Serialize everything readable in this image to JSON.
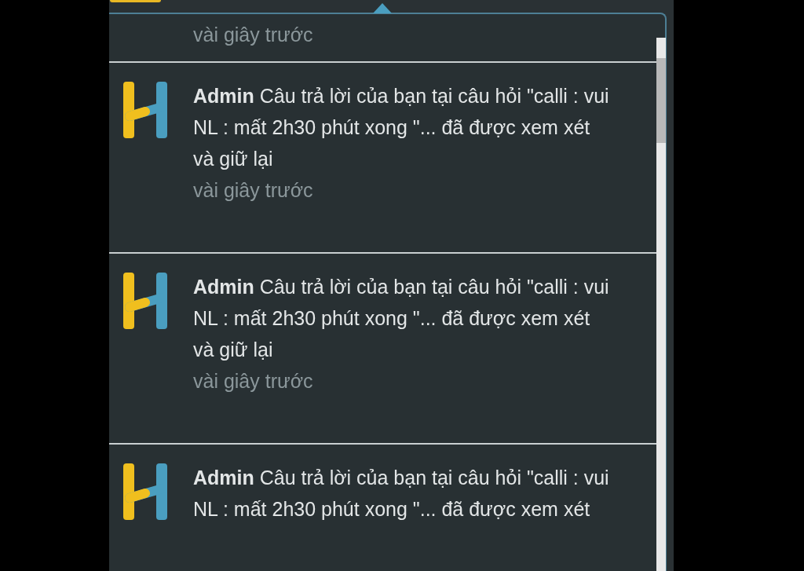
{
  "notifications": [
    {
      "kind": "partial",
      "time": "vài giây trước"
    },
    {
      "kind": "full",
      "author": "Admin",
      "message": "Câu trả lời của bạn tại câu hỏi \"calli : vui\nNL : mất 2h30 phút xong \"... đã được xem xét và giữ lại",
      "time": "vài giây trước"
    },
    {
      "kind": "full",
      "author": "Admin",
      "message": "Câu trả lời của bạn tại câu hỏi \"calli : vui\nNL : mất 2h30 phút xong \"... đã được xem xét và giữ lại",
      "time": "vài giây trước"
    },
    {
      "kind": "full",
      "author": "Admin",
      "message": "Câu trả lời của bạn tại câu hỏi \"calli : vui\nNL : mất 2h30 phút xong \"... đã được xem xét"
    }
  ]
}
